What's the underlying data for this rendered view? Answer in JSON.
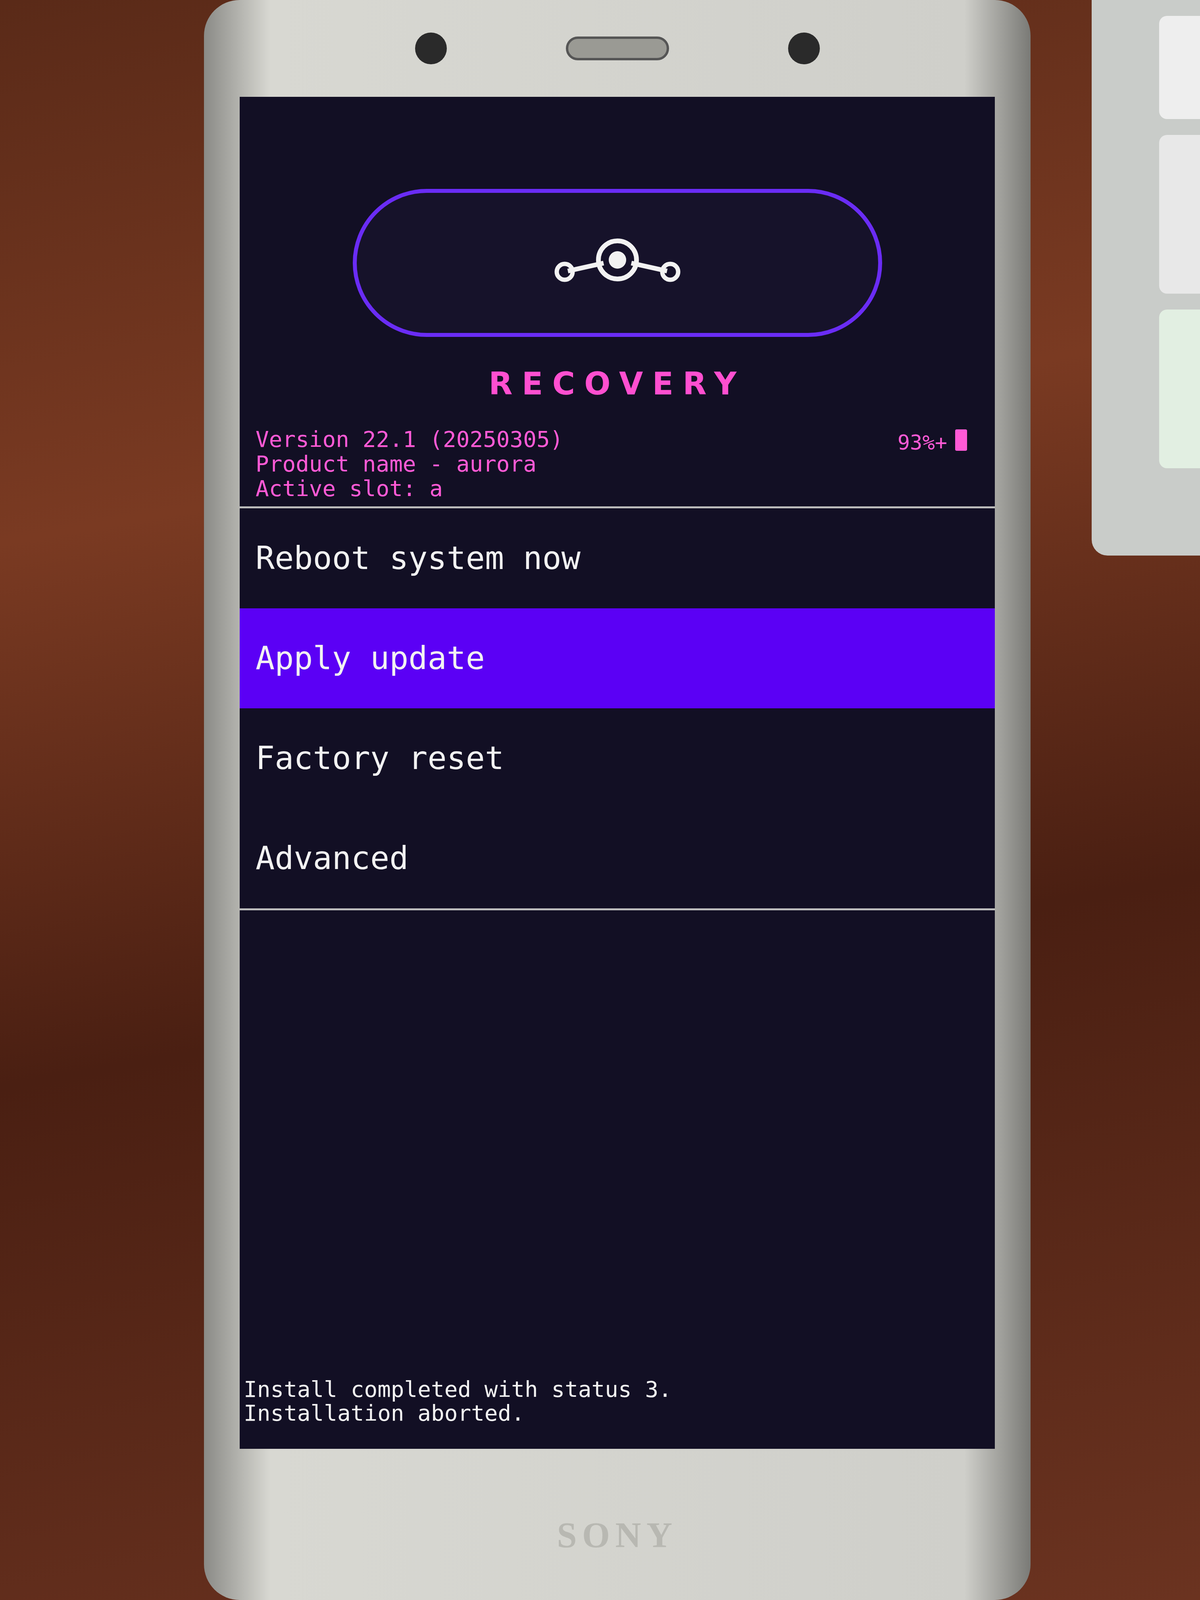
{
  "screen": {
    "title": "RECOVERY",
    "info": [
      "Version 22.1 (20250305)",
      "Product name - aurora",
      "Active slot: a"
    ],
    "battery": "93%+"
  },
  "menu": [
    {
      "label": "Reboot system now",
      "selected": false
    },
    {
      "label": "Apply update",
      "selected": true
    },
    {
      "label": "Factory reset",
      "selected": false
    },
    {
      "label": "Advanced",
      "selected": false
    }
  ],
  "log": [
    "Install completed with status 3.",
    "Installation aborted."
  ],
  "brand": "SONY"
}
